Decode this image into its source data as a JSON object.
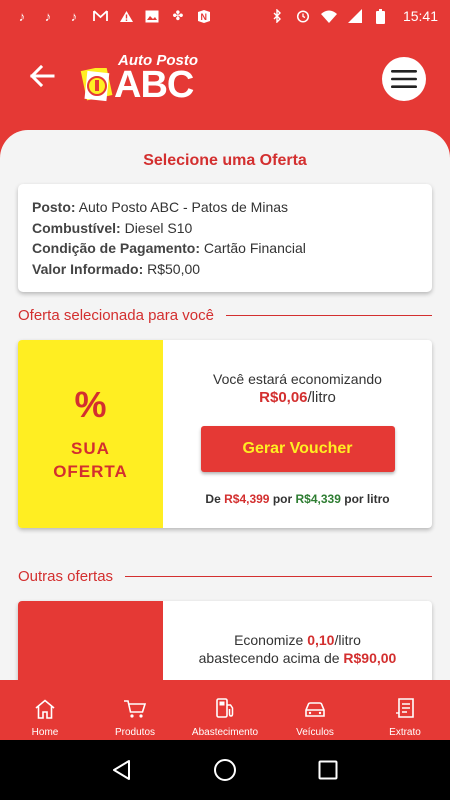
{
  "status_bar": {
    "time": "15:41",
    "icons_left": [
      "tiktok-icon",
      "tiktok-icon",
      "tiktok-icon",
      "gmail-icon",
      "warning-icon",
      "image-icon",
      "grid-icon",
      "n-icon"
    ],
    "icons_right": [
      "bluetooth-icon",
      "alarm-icon",
      "wifi-icon",
      "signal-icon",
      "battery-icon"
    ]
  },
  "header": {
    "logo_top": "Auto Posto",
    "logo_main": "ABC",
    "colors": {
      "primary": "#e53935",
      "accent": "#ffee22"
    }
  },
  "page": {
    "title": "Selecione uma Oferta"
  },
  "info": {
    "posto_label": "Posto:",
    "posto_value": "Auto Posto ABC - Patos de Minas",
    "combustivel_label": "Combustível:",
    "combustivel_value": "Diesel S10",
    "condicao_label": "Condição de Pagamento:",
    "condicao_value": "Cartão Financial",
    "valor_label": "Valor Informado:",
    "valor_value": "R$50,00"
  },
  "selected_offer": {
    "section_title": "Oferta selecionada para você",
    "badge_symbol": "%",
    "badge_line1": "SUA",
    "badge_line2": "OFERTA",
    "save_text": "Você estará economizando",
    "save_value": "R$0,06",
    "save_unit": "/litro",
    "button_label": "Gerar Voucher",
    "price_de": "De",
    "price_old": "R$4,399",
    "price_por": "por",
    "price_new": "R$4,339",
    "price_suffix": "por litro"
  },
  "other_offers": {
    "section_title": "Outras ofertas",
    "items": [
      {
        "badge_symbol": "%",
        "text1": "Economize",
        "value": "0,10",
        "unit": "/litro",
        "text2": "abastecendo acima de",
        "min_value": "R$90,00"
      }
    ]
  },
  "bottom_nav": [
    {
      "label": "Home",
      "icon": "home-icon"
    },
    {
      "label": "Produtos",
      "icon": "cart-icon"
    },
    {
      "label": "Abastecimento",
      "icon": "fuel-pump-icon"
    },
    {
      "label": "Veículos",
      "icon": "car-icon"
    },
    {
      "label": "Extrato",
      "icon": "receipt-icon"
    }
  ]
}
